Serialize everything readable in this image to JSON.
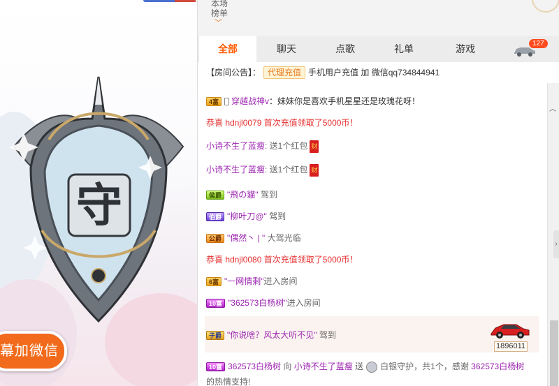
{
  "ranking": {
    "label": "本场榜单"
  },
  "tabs": [
    {
      "label": "全部",
      "active": true
    },
    {
      "label": "聊天",
      "active": false
    },
    {
      "label": "点歌",
      "active": false
    },
    {
      "label": "礼单",
      "active": false
    },
    {
      "label": "游戏",
      "active": false
    }
  ],
  "car_badge": "127",
  "notice": {
    "prefix": "【房间公告】：",
    "tag": "代理充值",
    "text": "手机用户充值 加 微信qq734844941"
  },
  "stream": {
    "emblem_char": "守",
    "wechat_label": "幕加微信"
  },
  "messages": [
    {
      "badge": "4富",
      "user": "穿越战神v",
      "text": "：妹妹你是喜欢手机星星还是玫瑰花呀！"
    },
    {
      "text": "恭喜 hdnjl0079 首次充值领取了5000币！"
    },
    {
      "user": "小诗不生了蓝瘦",
      "text": ": 送1个红包",
      "icon": "财"
    },
    {
      "user": "小诗不生了蓝瘦",
      "text": ": 送1个红包",
      "icon": "财"
    },
    {
      "badge": "侯爵",
      "user": "\"飛の貓\"",
      "text": "驾到"
    },
    {
      "badge": "伯爵",
      "user": "\"柳叶刀@\"",
      "text": "驾到"
    },
    {
      "badge": "公爵",
      "user": "\"偶然丶 | \"",
      "text": "大驾光临"
    },
    {
      "text": "恭喜 hdnjl0080 首次充值领取了5000币！"
    },
    {
      "badge": "6富",
      "user": "\"一网情剩\"",
      "text": "进入房间"
    },
    {
      "badge": "10富",
      "user": "\"362573白杨树\"",
      "text": "进入房间"
    },
    {
      "badge": "子爵",
      "user": "\"你说啥？风太大听不见\"",
      "text": "驾到",
      "car_number": "1896011"
    },
    {
      "badge": "10富",
      "user": "362573白杨树",
      "to": "向",
      "target": "小诗不生了蓝瘦",
      "send": "送",
      "gift": "白银守护，共1个，感谢",
      "thanks_user": "362573白杨树",
      "line2": "的热情支持!"
    }
  ]
}
